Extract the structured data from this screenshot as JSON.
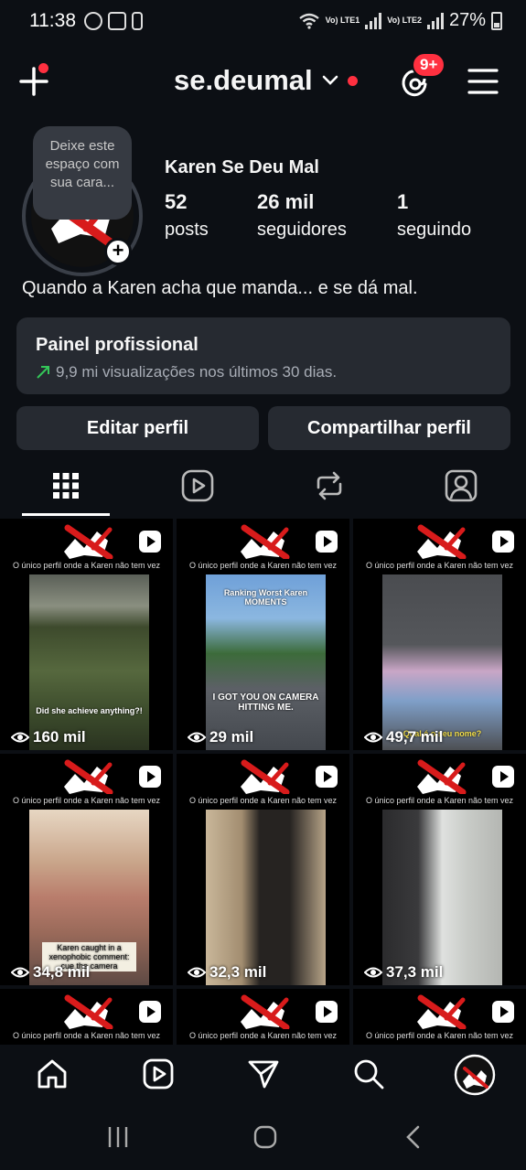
{
  "status_bar": {
    "time": "11:38",
    "sim1": "Vo) LTE1",
    "sim2": "Vo) LTE2",
    "battery": "27%"
  },
  "header": {
    "username": "se.deumal",
    "notification_badge": "9+"
  },
  "profile": {
    "note": "Deixe este espaço com sua cara...",
    "display_name": "Karen Se Deu Mal",
    "posts_count": "52",
    "posts_label": "posts",
    "followers_count": "26 mil",
    "followers_label": "seguidores",
    "following_count": "1",
    "following_label": "seguindo",
    "bio": "Quando a Karen acha que manda... e se dá mal."
  },
  "pro_dashboard": {
    "title": "Painel profissional",
    "subtitle": "9,9 mi visualizações nos últimos 30 dias."
  },
  "actions": {
    "edit": "Editar perfil",
    "share": "Compartilhar perfil"
  },
  "tabs": [
    "posts-grid",
    "reels",
    "reposts",
    "tagged"
  ],
  "grid": {
    "caption": "O único perfil onde a Karen não tem vez",
    "posts": [
      {
        "views": "160 mil",
        "overlay": "Did she achieve anything?!"
      },
      {
        "views": "29 mil",
        "overlay": "Ranking Worst Karen MOMENTS",
        "overlay2": "I GOT YOU ON CAMERA HITTING ME."
      },
      {
        "views": "49,7 mil",
        "overlay": "Qual é o seu nome?"
      },
      {
        "views": "34,8 mil",
        "overlay": "Karen caught in a xenophobic comment: cue the camera"
      },
      {
        "views": "32,3 mil",
        "overlay": ""
      },
      {
        "views": "37,3 mil",
        "overlay": ""
      }
    ]
  },
  "colors": {
    "background": "#0c0f14",
    "surface": "#262a31",
    "accent_red": "#ff3040",
    "growth_green": "#34c759"
  }
}
